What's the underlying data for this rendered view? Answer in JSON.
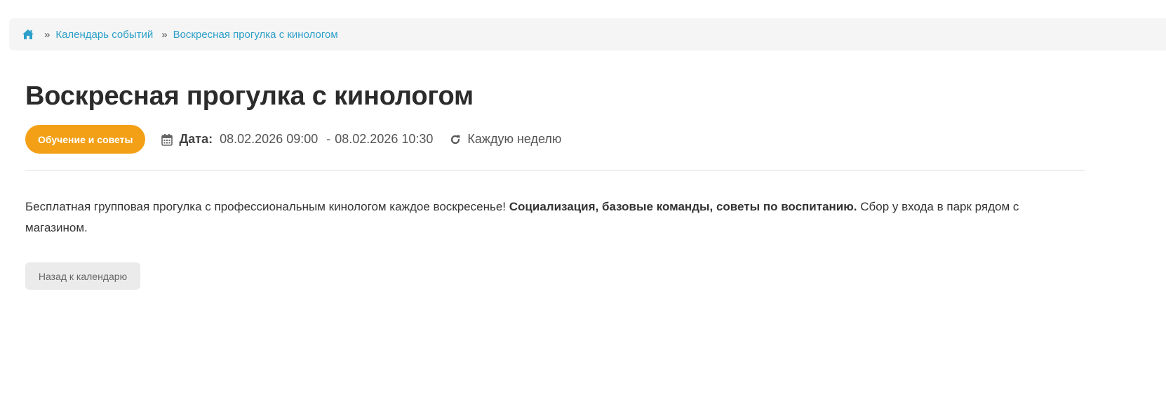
{
  "breadcrumb": {
    "home_icon": "home-icon",
    "separator": "»",
    "items": [
      {
        "label": "Календарь событий"
      },
      {
        "label": "Воскресная прогулка с кинологом"
      }
    ]
  },
  "event": {
    "title": "Воскресная прогулка с кинологом",
    "category": "Обучение и советы",
    "date_label": "Дата:",
    "date_start": "08.02.2026 09:00",
    "date_separator": "-",
    "date_end": "08.02.2026 10:30",
    "recurrence": "Каждую неделю",
    "description": {
      "intro": "Бесплатная групповая прогулка с профессиональным кинологом каждое воскресенье! ",
      "bold": "Социализация, базовые команды, советы по воспитанию.",
      "outro": " Сбор у входа в парк рядом с магазином."
    }
  },
  "actions": {
    "back_label": "Назад к календарю"
  },
  "colors": {
    "accent": "#f4a017",
    "link": "#2b9fc9",
    "breadcrumb_bg": "#f5f5f5",
    "button_bg": "#ebebeb"
  },
  "icons": {
    "calendar": "calendar-icon",
    "repeat": "repeat-icon"
  }
}
